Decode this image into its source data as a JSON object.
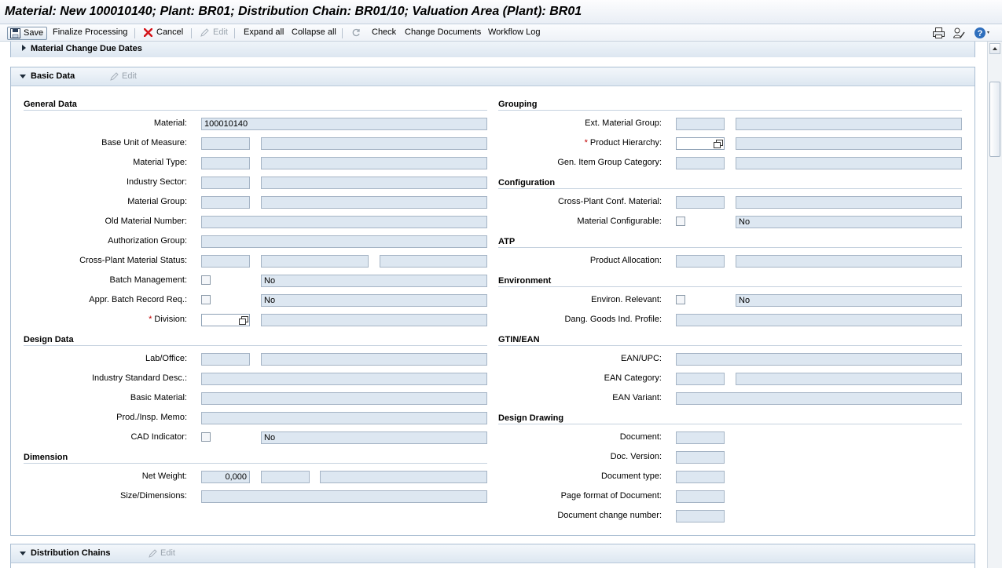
{
  "window": {
    "title": "Material: New 100010140; Plant: BR01; Distribution Chain: BR01/10; Valuation Area (Plant): BR01"
  },
  "toolbar": {
    "save": "Save",
    "finalize": "Finalize Processing",
    "cancel": "Cancel",
    "edit": "Edit",
    "expand_all": "Expand all",
    "collapse_all": "Collapse all",
    "check": "Check",
    "change_documents": "Change Documents",
    "workflow_log": "Workflow Log"
  },
  "sections": {
    "change_due_dates": "Material Change Due Dates",
    "basic_data": "Basic Data",
    "basic_edit": "Edit",
    "distribution_chains": "Distribution Chains",
    "dist_edit": "Edit"
  },
  "general": {
    "title": "General Data",
    "material_label": "Material:",
    "material_value": "100010140",
    "base_uom_label": "Base Unit of Measure:",
    "material_type_label": "Material Type:",
    "industry_sector_label": "Industry Sector:",
    "material_group_label": "Material Group:",
    "old_material_label": "Old Material Number:",
    "auth_group_label": "Authorization Group:",
    "xplant_status_label": "Cross-Plant Material Status:",
    "batch_mgmt_label": "Batch Management:",
    "batch_mgmt_value": "No",
    "appr_batch_label": "Appr. Batch Record Req.:",
    "appr_batch_value": "No",
    "division_label": "Division:",
    "required_mark": "*"
  },
  "design": {
    "title": "Design Data",
    "lab_label": "Lab/Office:",
    "industry_std_label": "Industry Standard Desc.:",
    "basic_material_label": "Basic Material:",
    "prod_memo_label": "Prod./Insp. Memo:",
    "cad_label": "CAD Indicator:",
    "cad_value": "No"
  },
  "dimension": {
    "title": "Dimension",
    "net_weight_label": "Net Weight:",
    "net_weight_value": "0,000",
    "size_label": "Size/Dimensions:"
  },
  "grouping": {
    "title": "Grouping",
    "ext_group_label": "Ext. Material Group:",
    "prod_hier_label": "Product Hierarchy:",
    "gen_item_label": "Gen. Item Group Category:"
  },
  "configuration": {
    "title": "Configuration",
    "xplant_conf_label": "Cross-Plant Conf. Material:",
    "configurable_label": "Material Configurable:",
    "configurable_value": "No"
  },
  "atp": {
    "title": "ATP",
    "prod_alloc_label": "Product Allocation:"
  },
  "environment": {
    "title": "Environment",
    "relevant_label": "Environ. Relevant:",
    "relevant_value": "No",
    "dang_goods_label": "Dang. Goods Ind. Profile:"
  },
  "gtin": {
    "title": "GTIN/EAN",
    "ean_label": "EAN/UPC:",
    "ean_cat_label": "EAN Category:",
    "ean_variant_label": "EAN Variant:"
  },
  "drawing": {
    "title": "Design Drawing",
    "document_label": "Document:",
    "doc_version_label": "Doc. Version:",
    "doc_type_label": "Document type:",
    "page_format_label": "Page format of Document:",
    "doc_change_label": "Document change number:"
  }
}
